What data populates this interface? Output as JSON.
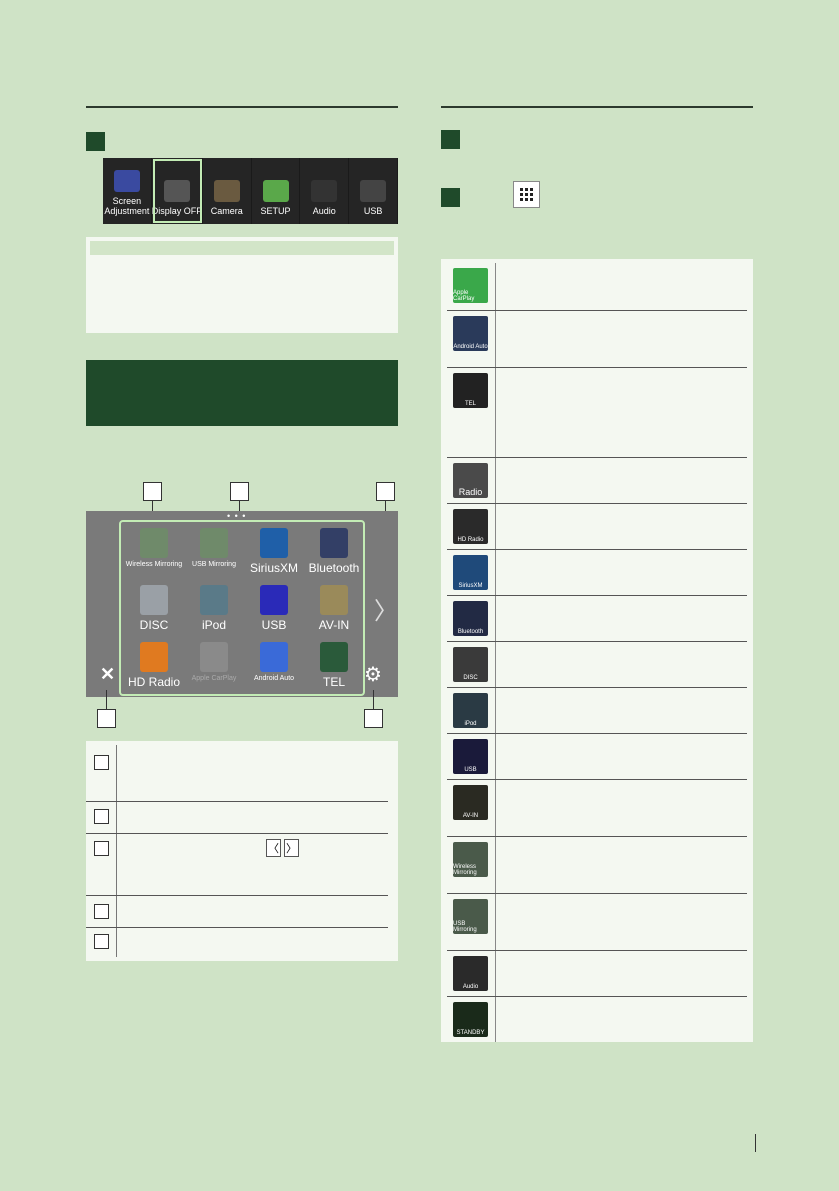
{
  "strip": {
    "tiles": [
      {
        "label": "Screen\nAdjustment",
        "icon": "screen-adjust-icon",
        "color": "#3a4aa0"
      },
      {
        "label": "Display OFF",
        "icon": "display-off-icon",
        "color": "#555555"
      },
      {
        "label": "Camera",
        "icon": "camera-icon",
        "color": "#6a5a40"
      },
      {
        "label": "SETUP",
        "icon": "gear-icon",
        "color": "#5aa84a"
      },
      {
        "label": "Audio",
        "icon": "audio-icon",
        "color": "#333333"
      },
      {
        "label": "USB",
        "icon": "usb-icon",
        "color": "#444444"
      }
    ]
  },
  "home": {
    "apps": [
      {
        "label": "Wireless Mirroring",
        "icon": "wireless-mirroring-icon",
        "small": true,
        "color": "#6f8a6a"
      },
      {
        "label": "USB Mirroring",
        "icon": "usb-mirroring-icon",
        "small": true,
        "color": "#6f8a6a"
      },
      {
        "label": "SiriusXM",
        "icon": "siriusxm-icon",
        "small": false,
        "color": "#1f5fa8"
      },
      {
        "label": "Bluetooth",
        "icon": "bluetooth-icon",
        "small": false,
        "color": "#333f66"
      },
      {
        "label": "DISC",
        "icon": "disc-icon",
        "small": false,
        "color": "#9aa0a6"
      },
      {
        "label": "iPod",
        "icon": "ipod-icon",
        "small": false,
        "color": "#5a7a88"
      },
      {
        "label": "USB",
        "icon": "usb-stick-icon",
        "small": false,
        "color": "#2a2ab8"
      },
      {
        "label": "AV-IN",
        "icon": "av-in-icon",
        "small": false,
        "color": "#9a8a5a"
      },
      {
        "label": "HD Radio",
        "icon": "hd-radio-icon",
        "small": false,
        "color": "#e07a20"
      },
      {
        "label": "Apple CarPlay",
        "icon": "apple-carplay-icon",
        "small": true,
        "color": "#8a8a8a"
      },
      {
        "label": "Android Auto",
        "icon": "android-auto-icon",
        "small": true,
        "color": "#3a6ad8"
      },
      {
        "label": "TEL",
        "icon": "tel-icon",
        "small": false,
        "color": "#2a5a3a"
      }
    ],
    "dots": "• • •",
    "next_arrow": "〉",
    "close_glyph": "✕",
    "settings_glyph": "⚙"
  },
  "legend": {
    "arrows": [
      "〈",
      "〉"
    ]
  },
  "sources": [
    {
      "label": "Apple CarPlay",
      "icon": "apple-carplay-icon",
      "color": "#3aa84a"
    },
    {
      "label": "Android Auto",
      "icon": "android-auto-icon",
      "color": "#2a3a5a"
    },
    {
      "label": "TEL",
      "icon": "tel-icon",
      "color": "#222222"
    },
    {
      "label": "Radio",
      "icon": "radio-icon",
      "color": "#4a4a4a"
    },
    {
      "label": "HD Radio",
      "icon": "hd-radio-icon",
      "color": "#2a2a2a"
    },
    {
      "label": "SiriusXM",
      "icon": "siriusxm-icon",
      "color": "#1f4a7a"
    },
    {
      "label": "Bluetooth",
      "icon": "bluetooth-icon",
      "color": "#222a44"
    },
    {
      "label": "DISC",
      "icon": "disc-icon",
      "color": "#3a3a3a"
    },
    {
      "label": "iPod",
      "icon": "ipod-icon",
      "color": "#2a3a44"
    },
    {
      "label": "USB",
      "icon": "usb-stick-icon",
      "color": "#1a1a3a"
    },
    {
      "label": "AV-IN",
      "icon": "av-in-icon",
      "color": "#2a2a22"
    },
    {
      "label": "Wireless Mirroring",
      "icon": "wireless-mirroring-icon",
      "color": "#4a5a4a"
    },
    {
      "label": "USB Mirroring",
      "icon": "usb-mirroring-icon",
      "color": "#4a5a4a"
    },
    {
      "label": "Audio",
      "icon": "audio-icon",
      "color": "#2a2a2a"
    },
    {
      "label": "STANDBY",
      "icon": "standby-icon",
      "color": "#1a2a1a"
    }
  ],
  "colors": {
    "page_bg": "#cfe3c6",
    "accent_dark_green": "#1f4a2a",
    "highlight_green": "#c3ecb5",
    "panel_bg": "#f4f8f1"
  }
}
